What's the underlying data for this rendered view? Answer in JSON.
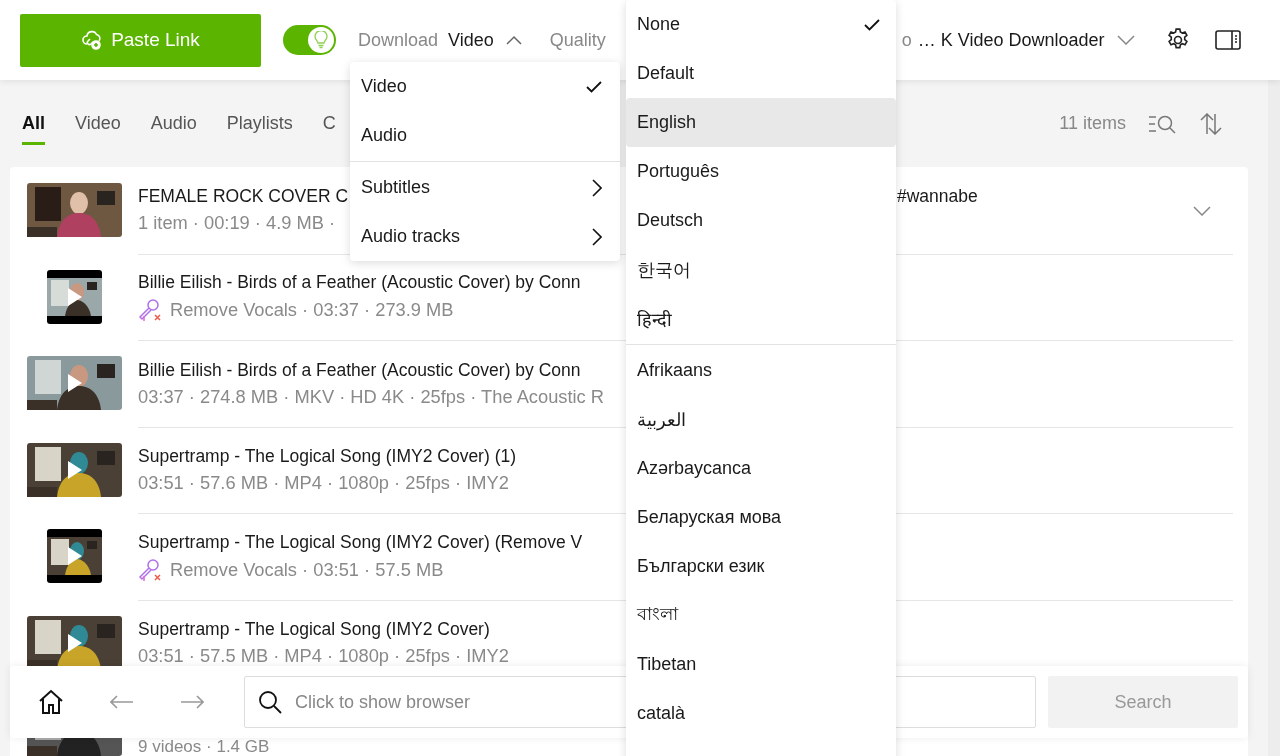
{
  "header": {
    "paste_button": "Paste Link",
    "smart_mode": {
      "on": true
    },
    "download_label": "Download",
    "download_value": "Video",
    "download_menu_open": true,
    "quality_label": "Quality",
    "covered_fragment": "o",
    "source_value": "… K Video Downloader"
  },
  "download_menu": {
    "groups": [
      [
        {
          "label": "Video",
          "checked": true,
          "submenu": false
        },
        {
          "label": "Audio",
          "checked": false,
          "submenu": false
        }
      ],
      [
        {
          "label": "Subtitles",
          "checked": false,
          "submenu": true
        },
        {
          "label": "Audio tracks",
          "checked": false,
          "submenu": true
        }
      ]
    ]
  },
  "tabs": [
    {
      "label": "All",
      "selected": true
    },
    {
      "label": "Video",
      "selected": false
    },
    {
      "label": "Audio",
      "selected": false
    },
    {
      "label": "Playlists",
      "selected": false
    },
    {
      "label": "C",
      "selected": false
    }
  ],
  "item_count": "11 items",
  "rows": [
    {
      "title": "FEMALE ROCK COVER C",
      "title_tail": "#wannabe",
      "meta": "1 item · 00:19 · 4.9 MB ·",
      "remove_vocals": false,
      "play": false,
      "expandable": true
    },
    {
      "title": "Billie Eilish - Birds of a Feather (Acoustic Cover) by Conn",
      "meta": "Remove Vocals · 03:37 · 273.9 MB",
      "remove_vocals": true,
      "play": true,
      "expandable": false
    },
    {
      "title": "Billie Eilish - Birds of a Feather (Acoustic Cover) by Conn",
      "meta": "03:37 · 274.8 MB · MKV · HD 4K · 25fps · The Acoustic R",
      "remove_vocals": false,
      "play": true,
      "expandable": false
    },
    {
      "title": "Supertramp - The Logical Song (IMY2 Cover) (1)",
      "meta": "03:51 · 57.6 MB · MP4 · 1080p · 25fps · IMY2",
      "remove_vocals": false,
      "play": true,
      "expandable": false
    },
    {
      "title": "Supertramp - The Logical Song (IMY2 Cover) (Remove V",
      "meta": "Remove Vocals · 03:51 · 57.5 MB",
      "remove_vocals": true,
      "play": true,
      "expandable": false
    },
    {
      "title": "Supertramp - The Logical Song (IMY2 Cover)",
      "meta": "03:51 · 57.5 MB · MP4 · 1080p · 25fps · IMY2",
      "remove_vocals": false,
      "play": true,
      "expandable": false
    },
    {
      "meta": "9 videos · 1.4 GB",
      "remove_vocals": false,
      "play": false,
      "expandable": false
    }
  ],
  "browser_bar": {
    "placeholder": "Click to show browser",
    "search_button": "Search",
    "search_disabled": true
  },
  "subtitle_menu": {
    "groups": [
      [
        {
          "label": "None",
          "checked": true,
          "highlighted": false
        },
        {
          "label": "Default",
          "checked": false,
          "highlighted": false
        },
        {
          "label": "English",
          "checked": false,
          "highlighted": true
        },
        {
          "label": "Português",
          "checked": false,
          "highlighted": false
        },
        {
          "label": "Deutsch",
          "checked": false,
          "highlighted": false
        },
        {
          "label": "한국어",
          "checked": false,
          "highlighted": false
        },
        {
          "label": "हिन्दी",
          "checked": false,
          "highlighted": false
        }
      ],
      [
        {
          "label": "Afrikaans",
          "checked": false,
          "highlighted": false
        },
        {
          "label": "العربية",
          "checked": false,
          "highlighted": false
        },
        {
          "label": "Azərbaycanca",
          "checked": false,
          "highlighted": false
        },
        {
          "label": "Беларуская мова",
          "checked": false,
          "highlighted": false
        },
        {
          "label": "Български език",
          "checked": false,
          "highlighted": false
        },
        {
          "label": "বাংলা",
          "checked": false,
          "highlighted": false
        },
        {
          "label": "Tibetan",
          "checked": false,
          "highlighted": false
        },
        {
          "label": "català",
          "checked": false,
          "highlighted": false
        }
      ]
    ]
  }
}
